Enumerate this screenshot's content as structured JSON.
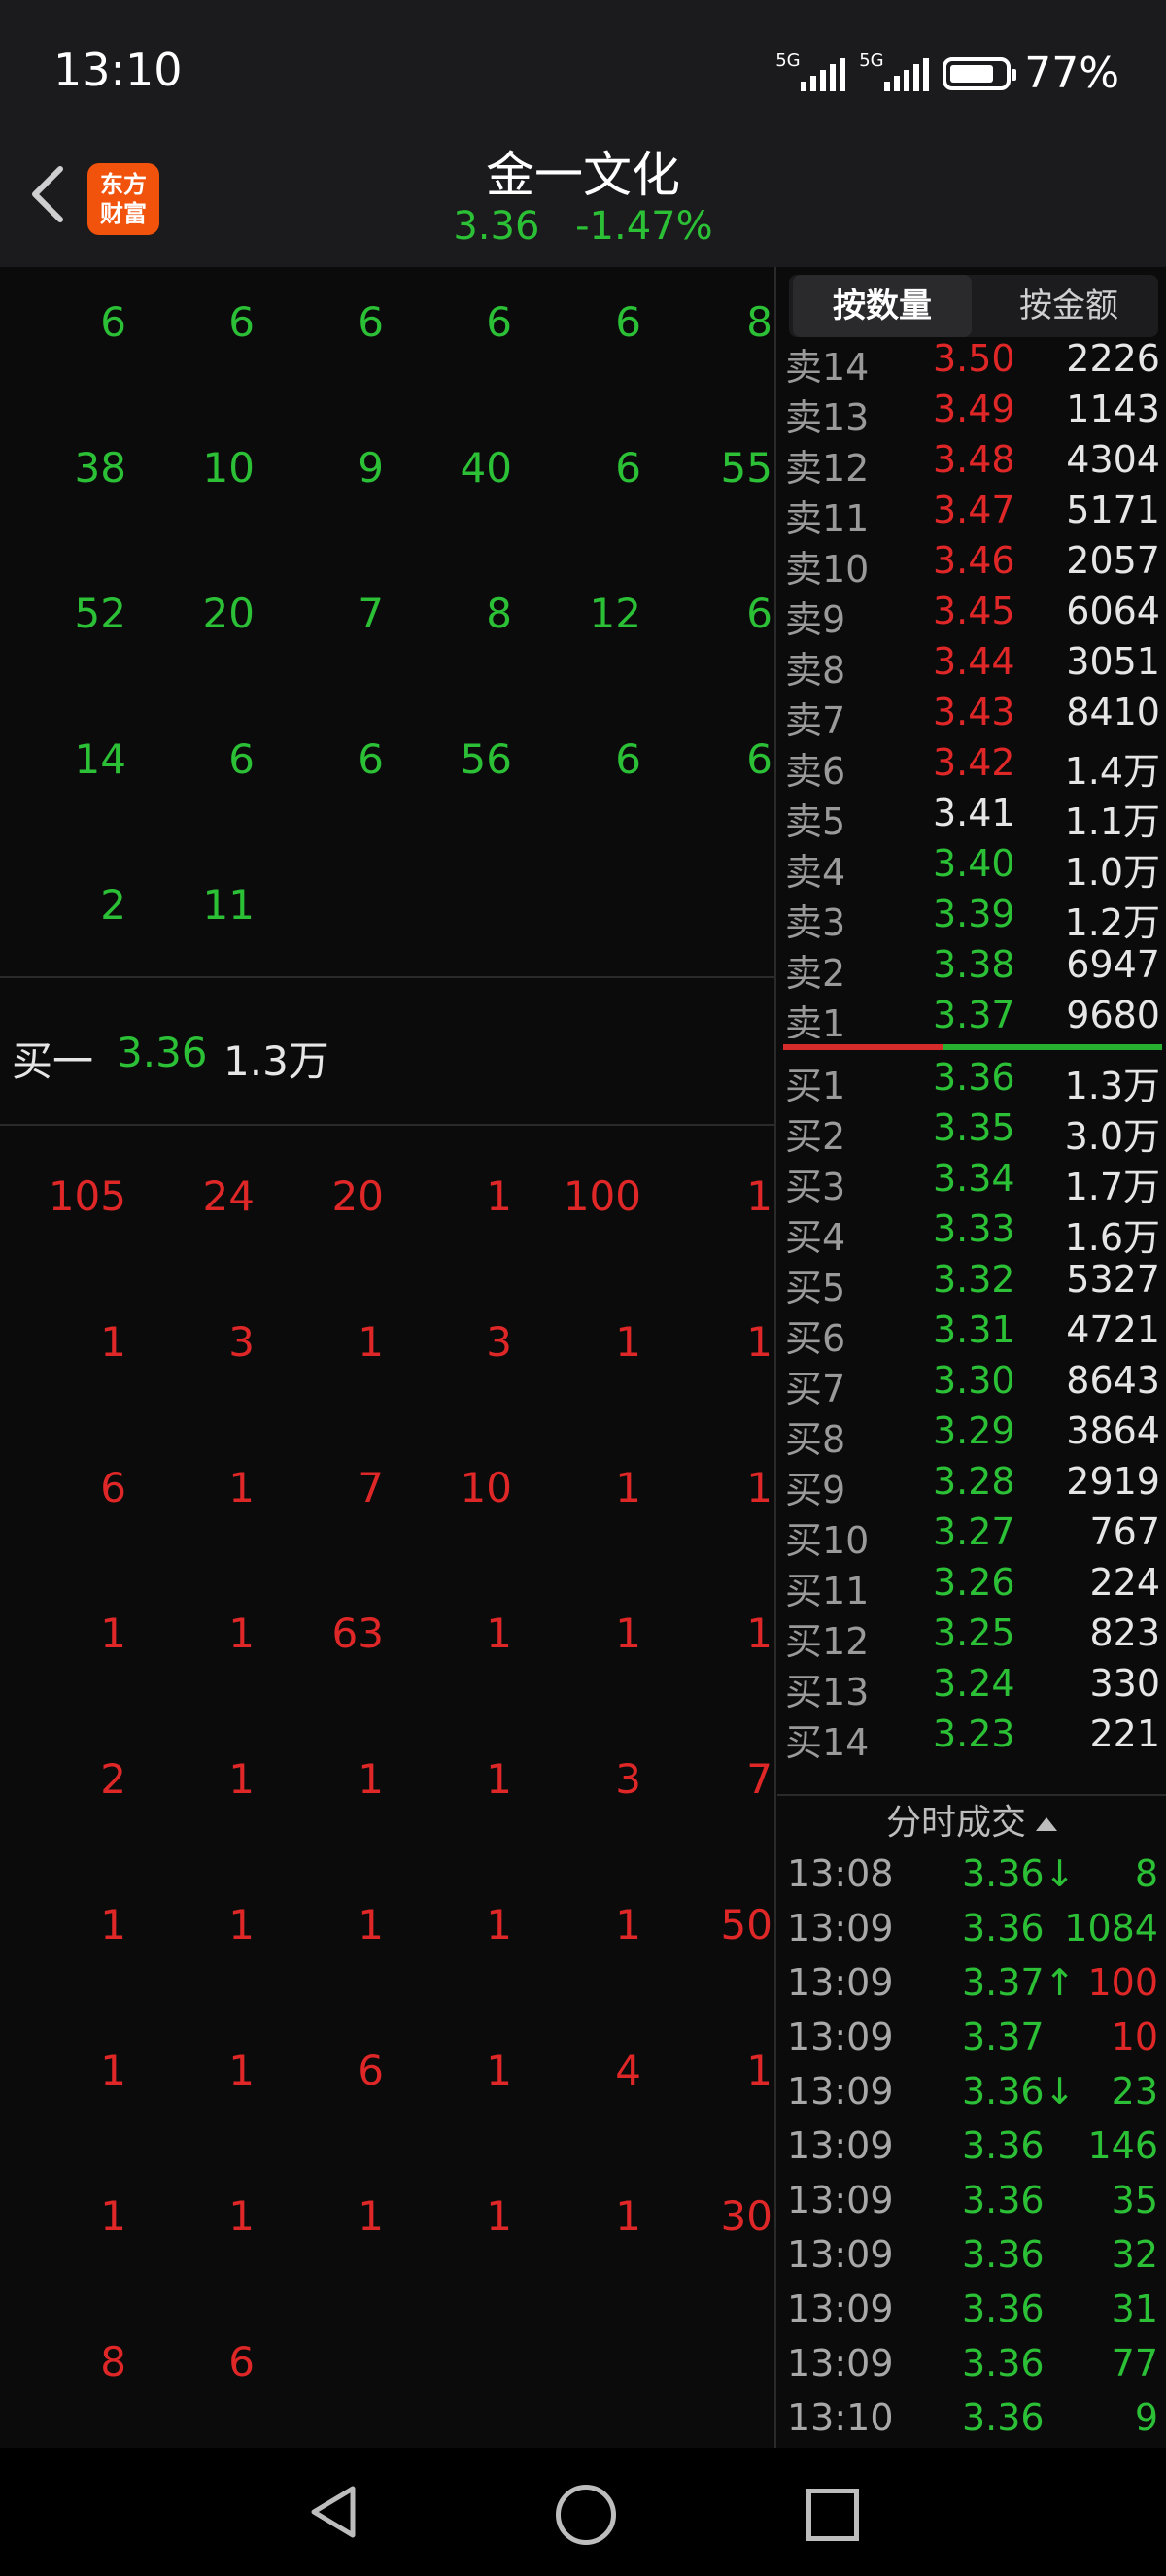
{
  "status": {
    "time": "13:10",
    "signal1": "5G",
    "signal2": "5G",
    "battery": "77%"
  },
  "header": {
    "title": "金一文化",
    "price": "3.36",
    "change": "-1.47%",
    "logo_line1": "东方",
    "logo_line2": "财富"
  },
  "sell_queue": [
    [
      "6",
      "6",
      "6",
      "6",
      "6",
      "8"
    ],
    [
      "38",
      "10",
      "9",
      "40",
      "6",
      "55"
    ],
    [
      "52",
      "20",
      "7",
      "8",
      "12",
      "6"
    ],
    [
      "14",
      "6",
      "6",
      "56",
      "6",
      "6"
    ],
    [
      "2",
      "11"
    ]
  ],
  "buy1": {
    "label": "买一",
    "price": "3.36",
    "volume": "1.3万"
  },
  "buy_queue": [
    [
      "105",
      "24",
      "20",
      "1",
      "100",
      "1"
    ],
    [
      "1",
      "3",
      "1",
      "3",
      "1",
      "1"
    ],
    [
      "6",
      "1",
      "7",
      "10",
      "1",
      "1"
    ],
    [
      "1",
      "1",
      "63",
      "1",
      "1",
      "1"
    ],
    [
      "2",
      "1",
      "1",
      "1",
      "3",
      "7"
    ],
    [
      "1",
      "1",
      "1",
      "1",
      "1",
      "50"
    ],
    [
      "1",
      "1",
      "6",
      "1",
      "4",
      "1"
    ],
    [
      "1",
      "1",
      "1",
      "1",
      "1",
      "30"
    ],
    [
      "8",
      "6"
    ]
  ],
  "tabs": {
    "by_quantity": "按数量",
    "by_amount": "按金额"
  },
  "asks": [
    {
      "label": "卖14",
      "price": "3.50",
      "qty": "2226",
      "color": "red"
    },
    {
      "label": "卖13",
      "price": "3.49",
      "qty": "1143",
      "color": "red"
    },
    {
      "label": "卖12",
      "price": "3.48",
      "qty": "4304",
      "color": "red"
    },
    {
      "label": "卖11",
      "price": "3.47",
      "qty": "5171",
      "color": "red"
    },
    {
      "label": "卖10",
      "price": "3.46",
      "qty": "2057",
      "color": "red"
    },
    {
      "label": "卖9",
      "price": "3.45",
      "qty": "6064",
      "color": "red"
    },
    {
      "label": "卖8",
      "price": "3.44",
      "qty": "3051",
      "color": "red"
    },
    {
      "label": "卖7",
      "price": "3.43",
      "qty": "8410",
      "color": "red"
    },
    {
      "label": "卖6",
      "price": "3.42",
      "qty": "1.4万",
      "color": "red"
    },
    {
      "label": "卖5",
      "price": "3.41",
      "qty": "1.1万",
      "color": "white"
    },
    {
      "label": "卖4",
      "price": "3.40",
      "qty": "1.0万",
      "color": "green"
    },
    {
      "label": "卖3",
      "price": "3.39",
      "qty": "1.2万",
      "color": "green"
    },
    {
      "label": "卖2",
      "price": "3.38",
      "qty": "6947",
      "color": "green"
    },
    {
      "label": "卖1",
      "price": "3.37",
      "qty": "9680",
      "color": "green"
    }
  ],
  "bids": [
    {
      "label": "买1",
      "price": "3.36",
      "qty": "1.3万"
    },
    {
      "label": "买2",
      "price": "3.35",
      "qty": "3.0万"
    },
    {
      "label": "买3",
      "price": "3.34",
      "qty": "1.7万"
    },
    {
      "label": "买4",
      "price": "3.33",
      "qty": "1.6万"
    },
    {
      "label": "买5",
      "price": "3.32",
      "qty": "5327"
    },
    {
      "label": "买6",
      "price": "3.31",
      "qty": "4721"
    },
    {
      "label": "买7",
      "price": "3.30",
      "qty": "8643"
    },
    {
      "label": "买8",
      "price": "3.29",
      "qty": "3864"
    },
    {
      "label": "买9",
      "price": "3.28",
      "qty": "2919"
    },
    {
      "label": "买10",
      "price": "3.27",
      "qty": "767"
    },
    {
      "label": "买11",
      "price": "3.26",
      "qty": "224"
    },
    {
      "label": "买12",
      "price": "3.25",
      "qty": "823"
    },
    {
      "label": "买13",
      "price": "3.24",
      "qty": "330"
    },
    {
      "label": "买14",
      "price": "3.23",
      "qty": "221"
    }
  ],
  "trades_title": "分时成交",
  "trades": [
    {
      "time": "13:08",
      "price": "3.36↓",
      "vol": "8",
      "pcolor": "green",
      "vcolor": "green"
    },
    {
      "time": "13:09",
      "price": "3.36",
      "vol": "1084",
      "pcolor": "green",
      "vcolor": "green"
    },
    {
      "time": "13:09",
      "price": "3.37↑",
      "vol": "100",
      "pcolor": "green",
      "vcolor": "red"
    },
    {
      "time": "13:09",
      "price": "3.37",
      "vol": "10",
      "pcolor": "green",
      "vcolor": "red"
    },
    {
      "time": "13:09",
      "price": "3.36↓",
      "vol": "23",
      "pcolor": "green",
      "vcolor": "green"
    },
    {
      "time": "13:09",
      "price": "3.36",
      "vol": "146",
      "pcolor": "green",
      "vcolor": "green"
    },
    {
      "time": "13:09",
      "price": "3.36",
      "vol": "35",
      "pcolor": "green",
      "vcolor": "green"
    },
    {
      "time": "13:09",
      "price": "3.36",
      "vol": "32",
      "pcolor": "green",
      "vcolor": "green"
    },
    {
      "time": "13:09",
      "price": "3.36",
      "vol": "31",
      "pcolor": "green",
      "vcolor": "green"
    },
    {
      "time": "13:09",
      "price": "3.36",
      "vol": "77",
      "pcolor": "green",
      "vcolor": "green"
    },
    {
      "time": "13:10",
      "price": "3.36",
      "vol": "9",
      "pcolor": "green",
      "vcolor": "green"
    }
  ]
}
